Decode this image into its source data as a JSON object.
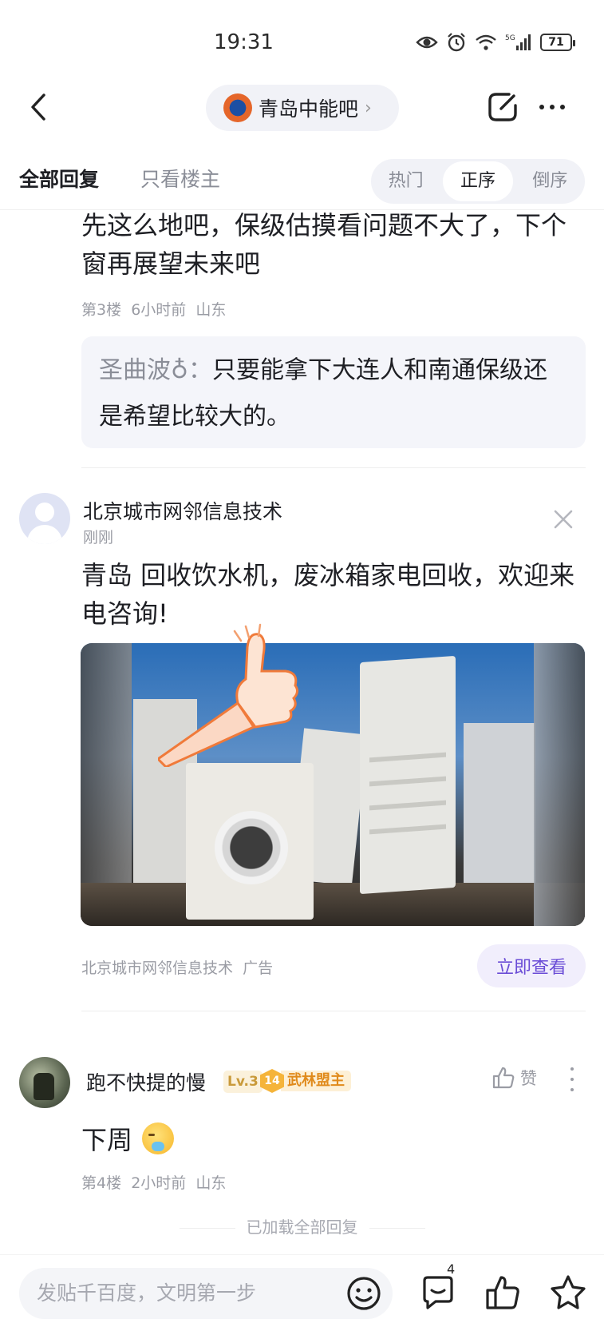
{
  "status_bar": {
    "time": "19:31",
    "battery": "71",
    "network": "5G"
  },
  "nav": {
    "forum_name": "青岛中能吧"
  },
  "tabs": {
    "all_replies": "全部回复",
    "owner_only": "只看楼主",
    "sort": [
      "热门",
      "正序",
      "倒序"
    ],
    "active_sort": "正序"
  },
  "post1": {
    "text": "先这么地吧，保级估摸看问题不大了，下个窗再展望未来吧",
    "floor": "第3楼",
    "time": "6小时前",
    "location": "山东",
    "sub_reply": {
      "author": "圣曲波♁：",
      "text": "只要能拿下大连人和南通保级还是希望比较大的。"
    }
  },
  "ad": {
    "name": "北京城市网邻信息技术",
    "time": "刚刚",
    "text": "青岛 回收饮水机，废冰箱家电回收，欢迎来电咨询!",
    "source": "北京城市网邻信息技术",
    "ad_tag": "广告",
    "cta": "立即查看"
  },
  "post2": {
    "user": "跑不快提的慢",
    "level": "Lv.3",
    "rank_num": "14",
    "rank_title": "武林盟主",
    "like_label": "赞",
    "text": "下周",
    "floor": "第4楼",
    "time": "2小时前",
    "location": "山东"
  },
  "footer": {
    "loaded": "已加载全部回复"
  },
  "bottom_bar": {
    "placeholder": "发贴千百度，文明第一步",
    "reply_count": "4"
  },
  "colors": {
    "accent": "#6a4cd6",
    "text": "#1e1f24",
    "muted": "#9a9ca4",
    "pill_bg": "#f1f2f7"
  }
}
